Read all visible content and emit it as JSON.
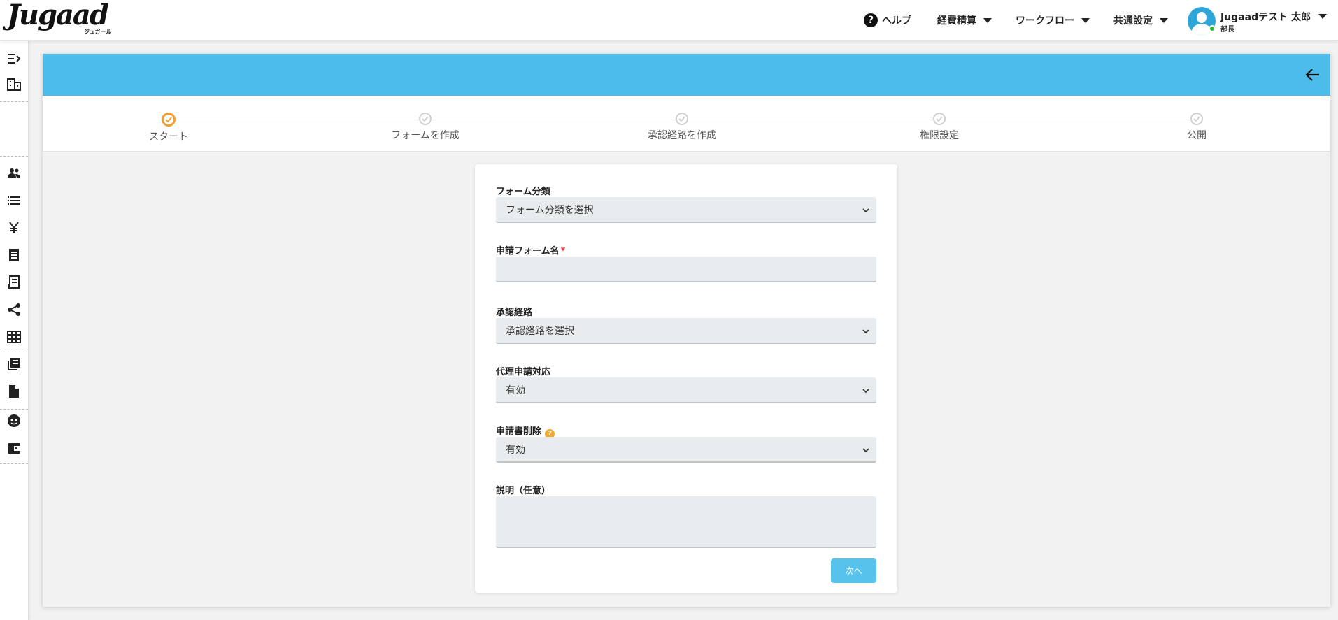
{
  "header": {
    "logo_text": "Jugaad",
    "logo_sub": "ジュガール",
    "help_label": "ヘルプ",
    "menus": [
      "経費精算",
      "ワークフロー",
      "共通設定"
    ],
    "user_name": "Jugaadテスト 太郎",
    "user_role": "部長"
  },
  "stepper": {
    "steps": [
      {
        "label": "スタート",
        "state": "active"
      },
      {
        "label": "フォームを作成",
        "state": "inactive"
      },
      {
        "label": "承認経路を作成",
        "state": "inactive"
      },
      {
        "label": "権限設定",
        "state": "inactive"
      },
      {
        "label": "公開",
        "state": "inactive"
      }
    ]
  },
  "form": {
    "category_label": "フォーム分類",
    "category_value": "フォーム分類を選択",
    "name_label": "申請フォーム名",
    "name_required_mark": "*",
    "route_label": "承認経路",
    "route_value": "承認経路を選択",
    "proxy_label": "代理申請対応",
    "proxy_value": "有効",
    "delete_label": "申請書削除",
    "delete_value": "有効",
    "desc_label": "説明（任意）",
    "next_label": "次へ"
  },
  "colors": {
    "header_blue": "#4cbcea",
    "active_step": "#f39c2f",
    "button": "#57c3ec"
  }
}
